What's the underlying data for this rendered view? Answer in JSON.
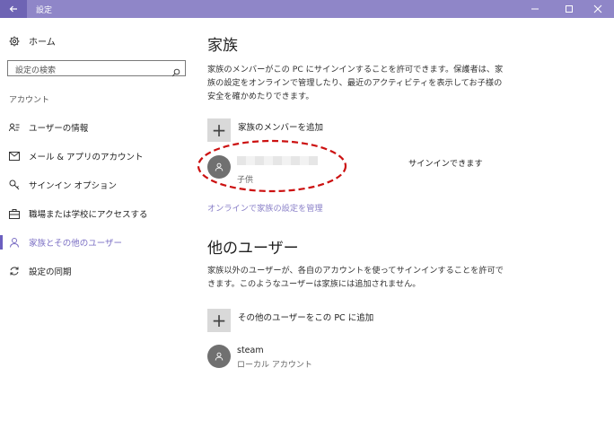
{
  "window": {
    "title": "設定"
  },
  "sidebar": {
    "home_label": "ホーム",
    "search_placeholder": "設定の検索",
    "section_label": "アカウント",
    "items": [
      {
        "label": "ユーザーの情報",
        "icon": "user-info-icon"
      },
      {
        "label": "メール & アプリのアカウント",
        "icon": "mail-icon"
      },
      {
        "label": "サインイン オプション",
        "icon": "key-icon"
      },
      {
        "label": "職場または学校にアクセスする",
        "icon": "briefcase-icon"
      },
      {
        "label": "家族とその他のユーザー",
        "icon": "person-icon",
        "active": true
      },
      {
        "label": "設定の同期",
        "icon": "sync-icon"
      }
    ]
  },
  "family": {
    "heading": "家族",
    "description": "家族のメンバーがこの PC にサインインすることを許可できます。保護者は、家族の設定をオンラインで管理したり、最近のアクティビティを表示してお子様の安全を確かめたりできます。",
    "add_label": "家族のメンバーを追加",
    "member_role": "子供",
    "member_status": "サインインできます",
    "manage_link": "オンラインで家族の設定を管理"
  },
  "others": {
    "heading": "他のユーザー",
    "description": "家族以外のユーザーが、各自のアカウントを使ってサインインすることを許可できます。このようなユーザーは家族には追加されません。",
    "add_label": "その他のユーザーをこの PC に追加",
    "user_name": "steam",
    "user_type": "ローカル アカウント"
  },
  "colors": {
    "accent": "#7b6fc4",
    "titlebar": "#8f86c8",
    "annotation": "#cc1111"
  }
}
